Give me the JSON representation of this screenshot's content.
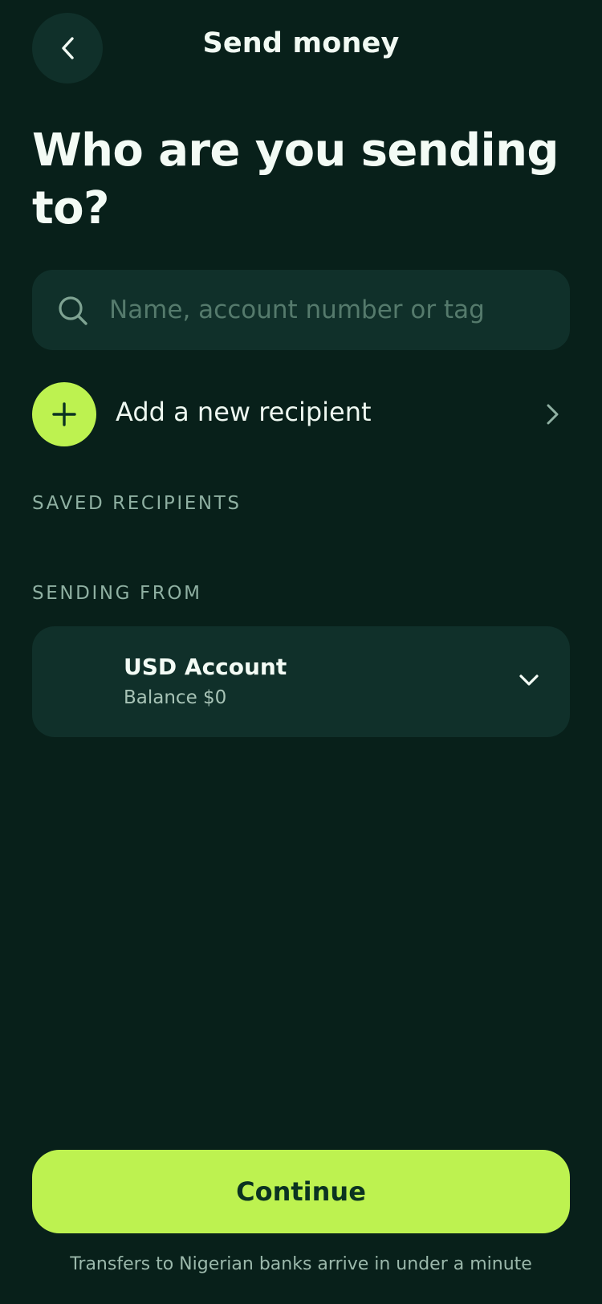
{
  "header": {
    "title": "Send money",
    "back_icon": "chevron-left-icon"
  },
  "heading": "Who are you sending to?",
  "search": {
    "placeholder": "Name, account number or tag",
    "value": "",
    "icon": "search-icon"
  },
  "add_recipient": {
    "label": "Add a new recipient",
    "icon": "plus-icon",
    "chevron_icon": "chevron-right-icon"
  },
  "sections": {
    "saved_recipients": "SAVED RECIPIENTS",
    "sending_from": "SENDING FROM"
  },
  "account": {
    "name": "USD Account",
    "balance": "Balance $0",
    "chevron_icon": "chevron-down-icon"
  },
  "continue_label": "Continue",
  "footnote": "Transfers to Nigerian banks arrive in under a minute",
  "colors": {
    "background": "#08201a",
    "card": "#10302a",
    "accent": "#bdf250",
    "accent_text": "#0b3321"
  }
}
